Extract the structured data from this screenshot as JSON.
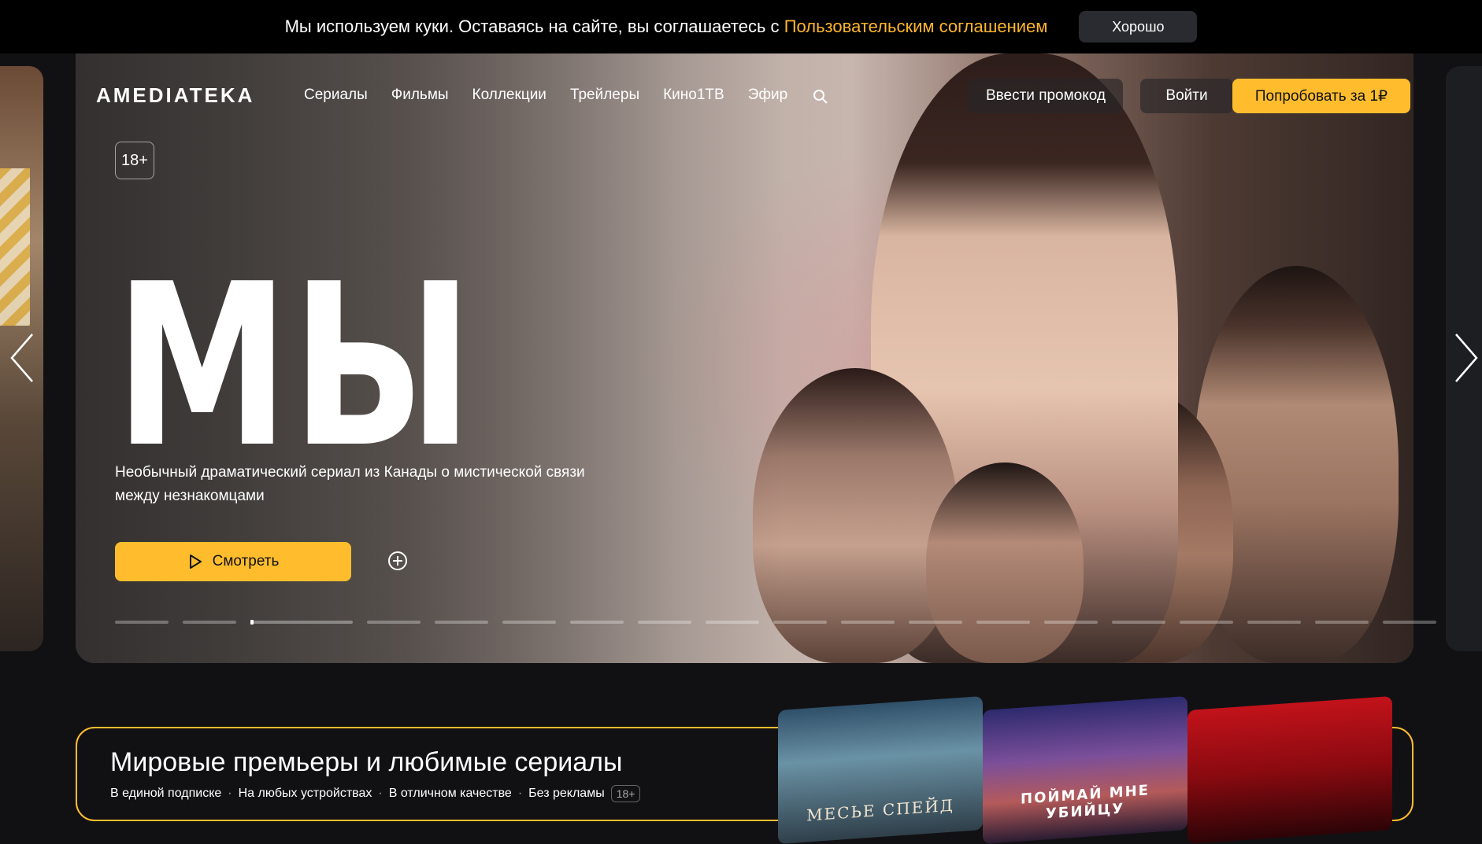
{
  "cookie": {
    "text": "Мы используем куки. Оставаясь на сайте, вы соглашаетесь с ",
    "link": "Пользовательским соглашением",
    "ok_label": "Хорошо"
  },
  "header": {
    "logo": "AMEDIATEKA",
    "nav": [
      "Сериалы",
      "Фильмы",
      "Коллекции",
      "Трейлеры",
      "Кино1ТВ",
      "Эфир"
    ],
    "promo_label": "Ввести промокод",
    "login_label": "Войти",
    "try_label": "Попробовать за 1₽"
  },
  "hero": {
    "age": "18+",
    "title": "МЫ",
    "description": "Необычный драматический сериал из Канады о мистической связи между незнакомцами",
    "watch_label": "Смотреть",
    "slide_count": 19,
    "active_slide": 2
  },
  "promo": {
    "title": "Мировые премьеры и любимые сериалы",
    "features": [
      "В единой подписке",
      "На любых устройствах",
      "В отличном качестве",
      "Без рекламы"
    ],
    "age": "18+",
    "posters": [
      {
        "label": "МЕСЬЕ СПЕЙД"
      },
      {
        "label": "ПОЙМАЙ МНЕ УБИЙЦУ"
      },
      {
        "label": ""
      }
    ]
  },
  "colors": {
    "accent": "#ffbd2e",
    "link": "#ffb72c",
    "background": "#111114"
  }
}
